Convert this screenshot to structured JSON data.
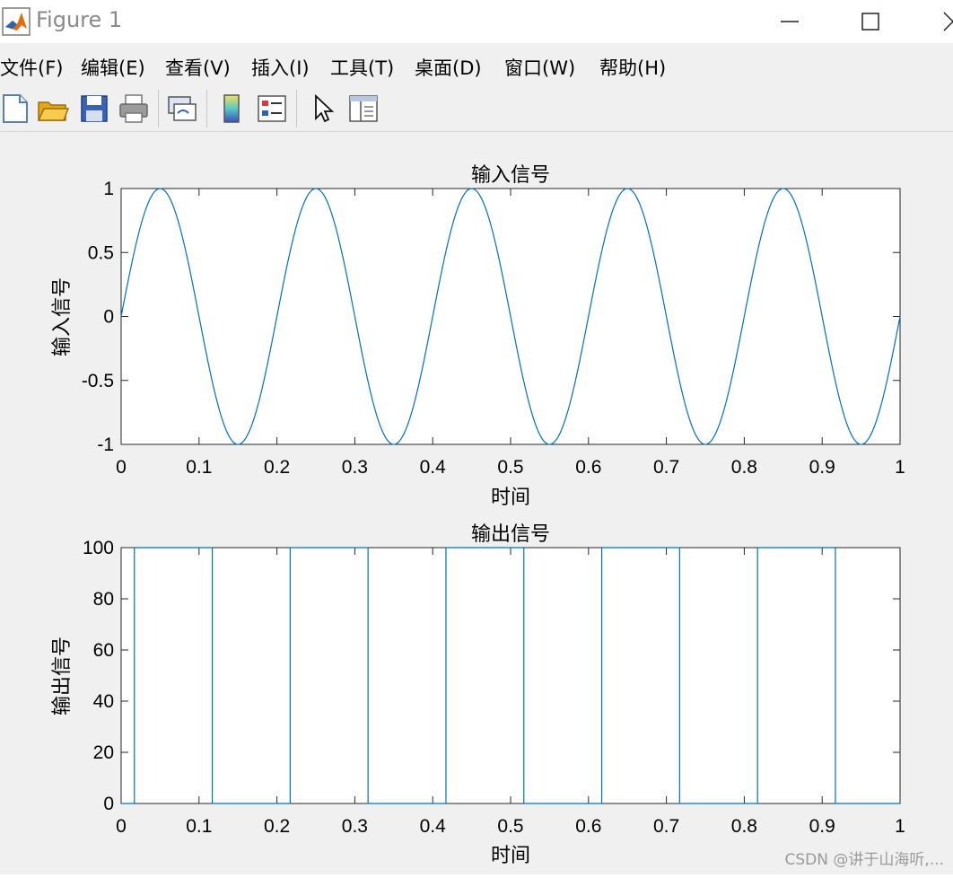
{
  "window": {
    "title": "Figure 1",
    "app_icon": "matlab-icon",
    "controls": [
      "minimize-icon",
      "maximize-icon"
    ]
  },
  "menu": {
    "items": [
      "文件(F)",
      "编辑(E)",
      "查看(V)",
      "插入(I)",
      "工具(T)",
      "桌面(D)",
      "窗口(W)",
      "帮助(H)"
    ]
  },
  "toolbar": {
    "tools": [
      "new-figure-icon",
      "open-file-icon",
      "save-icon",
      "print-icon",
      "link-plot-icon",
      "colorbar-icon",
      "legend-icon",
      "pointer-icon",
      "property-inspector-icon"
    ]
  },
  "colors": {
    "line": "#0072bd",
    "figure_bg": "#f0f0f0",
    "axes_bg": "#ffffff"
  },
  "chart_data": [
    {
      "type": "line",
      "title": "输入信号",
      "xlabel": "时间",
      "ylabel": "输入信号",
      "xlim": [
        0,
        1
      ],
      "ylim": [
        -1,
        1
      ],
      "xticks": [
        "0",
        "0.1",
        "0.2",
        "0.3",
        "0.4",
        "0.5",
        "0.6",
        "0.7",
        "0.8",
        "0.9",
        "1"
      ],
      "yticks": [
        "-1",
        "-0.5",
        "0",
        "0.5",
        "1"
      ],
      "series": [
        {
          "function": "sin(2*pi*5*t)",
          "frequency": 5,
          "amplitude": 1,
          "x_range": [
            0,
            1
          ]
        }
      ]
    },
    {
      "type": "line",
      "title": "输出信号",
      "xlabel": "时间",
      "ylabel": "输出信号",
      "xlim": [
        0,
        1
      ],
      "ylim": [
        0,
        100
      ],
      "xticks": [
        "0",
        "0.1",
        "0.2",
        "0.3",
        "0.4",
        "0.5",
        "0.6",
        "0.7",
        "0.8",
        "0.9",
        "1"
      ],
      "yticks": [
        "0",
        "20",
        "40",
        "60",
        "80",
        "100"
      ],
      "series": [
        {
          "x": [
            0,
            0.017,
            0.017,
            0.117,
            0.117,
            0.217,
            0.217,
            0.317,
            0.317,
            0.417,
            0.417,
            0.517,
            0.517,
            0.617,
            0.617,
            0.717,
            0.717,
            0.817,
            0.817,
            0.917,
            0.917,
            1.0
          ],
          "y": [
            0,
            0,
            100,
            100,
            0,
            0,
            100,
            100,
            0,
            0,
            100,
            100,
            0,
            0,
            100,
            100,
            0,
            0,
            100,
            100,
            0,
            0
          ]
        }
      ]
    }
  ],
  "watermark": "CSDN @讲于山海听,..."
}
